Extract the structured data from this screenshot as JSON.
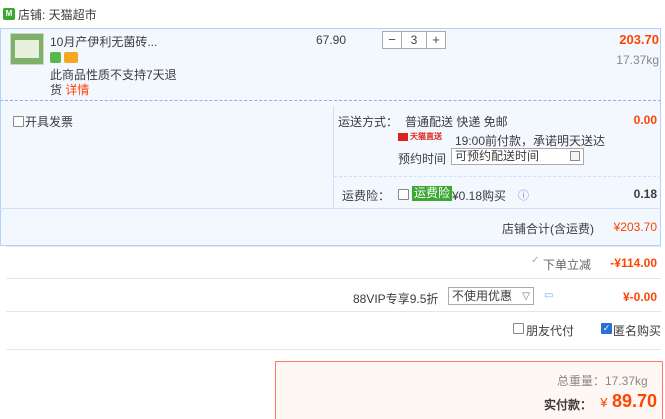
{
  "shop": {
    "label": "店铺: 天猫超市",
    "icon": "tmall-shop-icon"
  },
  "item": {
    "title": "10月产伊利无菌砖...",
    "unit_price": "67.90",
    "quantity": "3",
    "qty_minus": "−",
    "qty_plus": "+",
    "subtotal": "203.70",
    "weight": "17.37kg",
    "return_note": "此商品性质不支持7天退货",
    "return_link": "详情"
  },
  "options": {
    "invoice_label": "开具发票",
    "shipping_label": "运送方式：",
    "shipping_methods": "普通配送 快递 免邮",
    "shipping_fee": "0.00",
    "tmall_tag": "天猫直送",
    "promise": "19:00前付款，承诺明天送达",
    "reserve_label": "预约时间",
    "reserve_placeholder": "可预约配送时间",
    "insurance_label": "运费险：",
    "insurance_tag": "运费险",
    "insurance_price": "¥0.18购买",
    "insurance_fee": "0.18",
    "store_total_label": "店铺合计(含运费)",
    "store_total_value": "¥203.70"
  },
  "discount": {
    "label": "下单立减",
    "value": "-¥114.00"
  },
  "vip": {
    "label": "88VIP专享9.5折",
    "select_value": "不使用优惠",
    "value": "¥-0.00"
  },
  "extra": {
    "friend_pay_label": "朋友代付",
    "anonymous_label": "匿名购买"
  },
  "payment": {
    "weight_total": "总重量：17.37kg",
    "pay_label": "实付款：",
    "currency": "¥",
    "amount": "89.70"
  },
  "colors": {
    "accent": "#ff4400",
    "border_blue": "#b2d1ff",
    "panel_bg": "#f3f8ff",
    "green_tag": "#3aa831"
  }
}
